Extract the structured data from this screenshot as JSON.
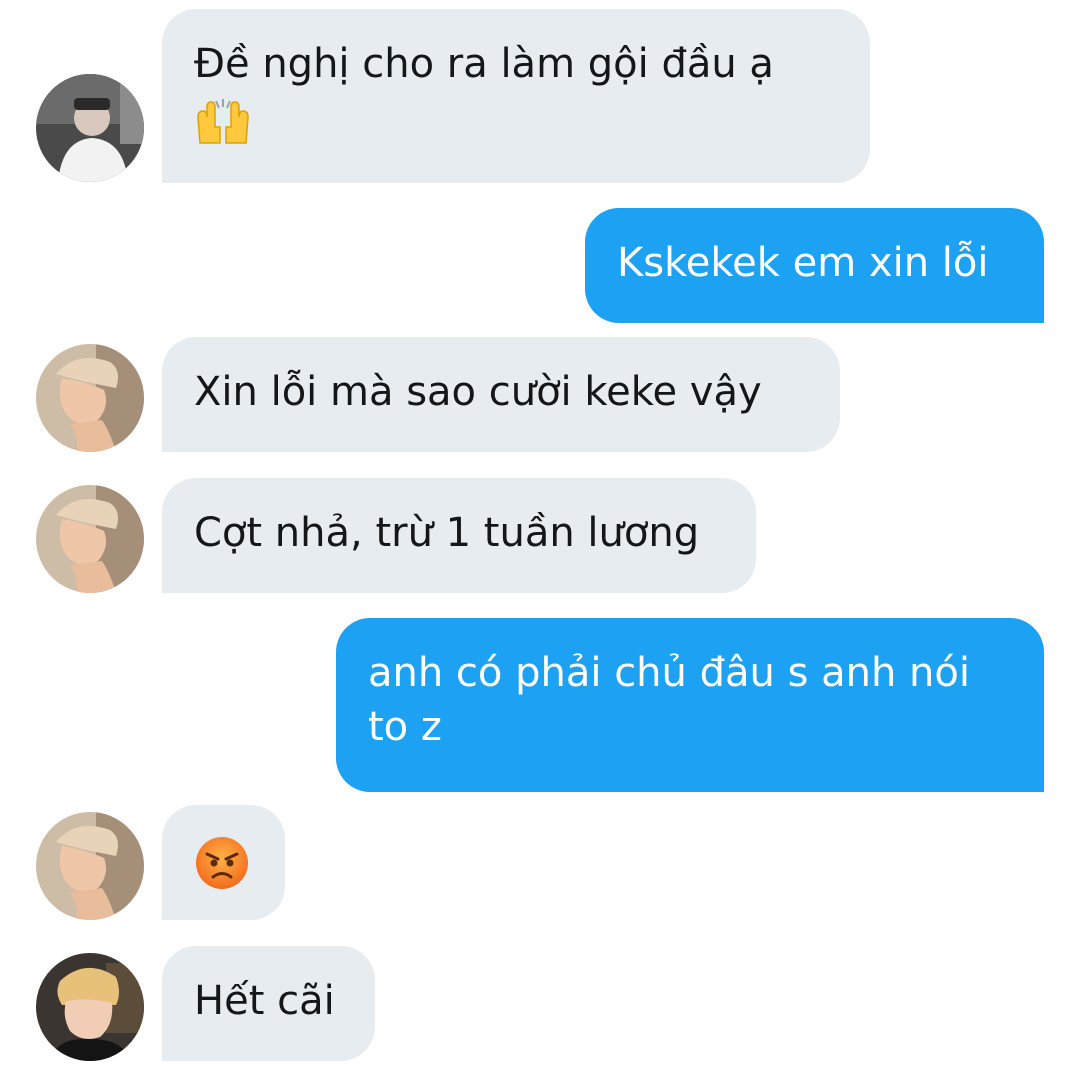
{
  "conversation": {
    "messages": [
      {
        "direction": "incoming",
        "text": "Đề nghị cho ra làm gội đầu ạ",
        "emoji": "raising-hands-emoji",
        "avatar": "avatar-user-a"
      },
      {
        "direction": "outgoing",
        "text": "Kskekek em xin lỗi"
      },
      {
        "direction": "incoming",
        "text": "Xin lỗi mà sao cười keke vậy",
        "avatar": "avatar-user-b"
      },
      {
        "direction": "incoming",
        "text": "Cợt nhả, trừ 1 tuần lương",
        "avatar": "avatar-user-b"
      },
      {
        "direction": "outgoing",
        "text": "anh có phải chủ đâu s anh nói to z"
      },
      {
        "direction": "incoming",
        "text": "",
        "emoji": "angry-face-emoji",
        "avatar": "avatar-user-b"
      },
      {
        "direction": "incoming",
        "text": "Hết cãi",
        "avatar": "avatar-user-c"
      }
    ]
  },
  "colors": {
    "incoming_bubble": "#e6ecf0",
    "outgoing_bubble": "#1da1f2",
    "incoming_text": "#14171a",
    "outgoing_text": "#ffffff"
  }
}
